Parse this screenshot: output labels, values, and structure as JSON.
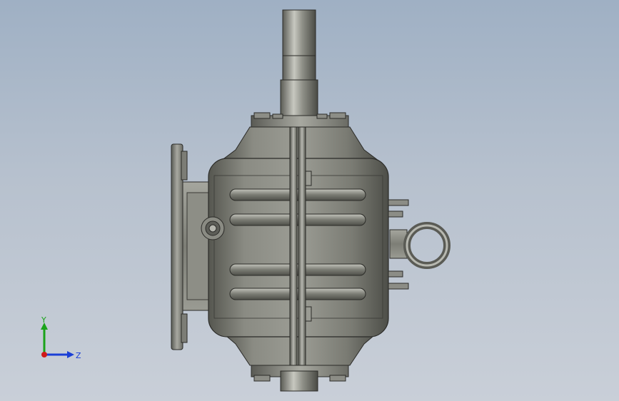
{
  "view": {
    "background_top": "#9fb0c4",
    "background_bottom": "#c9cfd8",
    "model_body_color": "#6f7068",
    "model_highlight_color": "#b9bab2"
  },
  "triad": {
    "y_label": "Y",
    "z_label": "Z",
    "y_color": "#1aa31a",
    "z_color": "#1a3fd6",
    "x_color": "#d01a1a"
  }
}
